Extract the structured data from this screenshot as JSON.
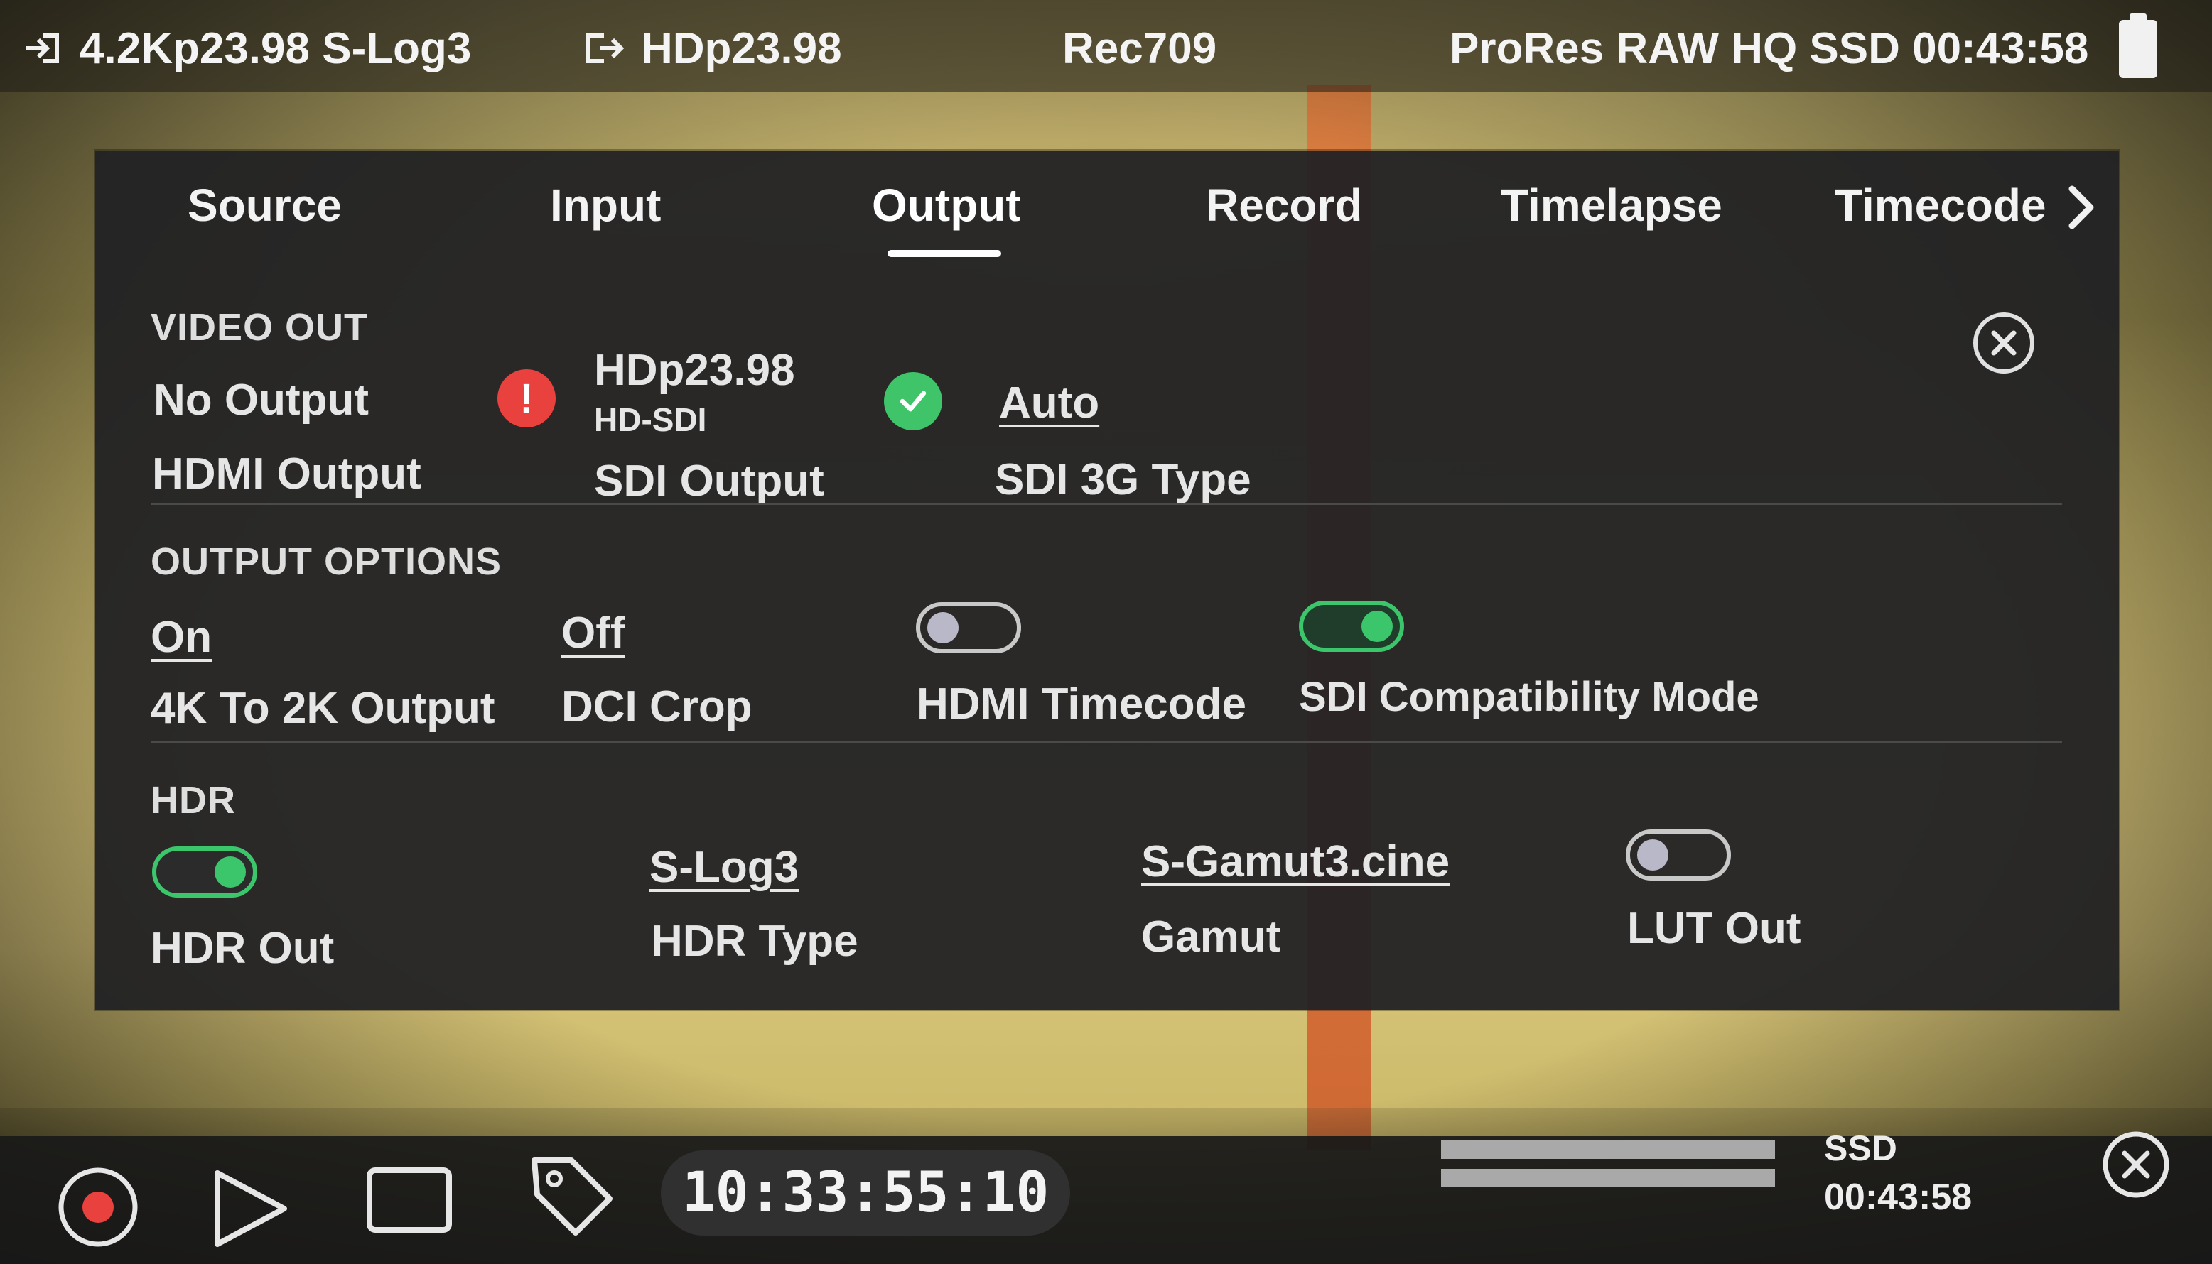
{
  "status_bar": {
    "input": "4.2Kp23.98 S-Log3",
    "output": "HDp23.98",
    "lut": "Rec709",
    "record": "ProRes RAW HQ SSD 00:43:58"
  },
  "tabs": [
    {
      "label": "Source"
    },
    {
      "label": "Input"
    },
    {
      "label": "Output",
      "active": true
    },
    {
      "label": "Record"
    },
    {
      "label": "Timelapse"
    },
    {
      "label": "Timecode"
    }
  ],
  "video_out": {
    "title": "VIDEO OUT",
    "hdmi": {
      "value": "No Output",
      "label": "HDMI Output",
      "status": "error"
    },
    "sdi": {
      "value": "HDp23.98",
      "sub": "HD-SDI",
      "label": "SDI Output",
      "status": "ok"
    },
    "sdi_3g": {
      "value": "Auto",
      "label": "SDI 3G Type"
    }
  },
  "output_options": {
    "title": "OUTPUT OPTIONS",
    "k4_to_2k": {
      "value": "On",
      "label": "4K To 2K Output"
    },
    "dci_crop": {
      "value": "Off",
      "label": "DCI Crop"
    },
    "hdmi_timecode": {
      "label": "HDMI Timecode",
      "enabled": false
    },
    "sdi_compat": {
      "label": "SDI Compatibility Mode",
      "enabled": true
    }
  },
  "hdr": {
    "title": "HDR",
    "hdr_out": {
      "label": "HDR Out",
      "enabled": true
    },
    "hdr_type": {
      "value": "S-Log3",
      "label": "HDR Type"
    },
    "gamut": {
      "value": "S-Gamut3.cine",
      "label": "Gamut"
    },
    "lut_out": {
      "label": "LUT Out",
      "enabled": false
    }
  },
  "transport": {
    "timecode": "10:33:55:10",
    "media_label": "SSD",
    "media_time": "00:43:58"
  },
  "colors": {
    "accent_green": "#3cc66b",
    "error_red": "#e8413e",
    "panel": "#222224"
  }
}
